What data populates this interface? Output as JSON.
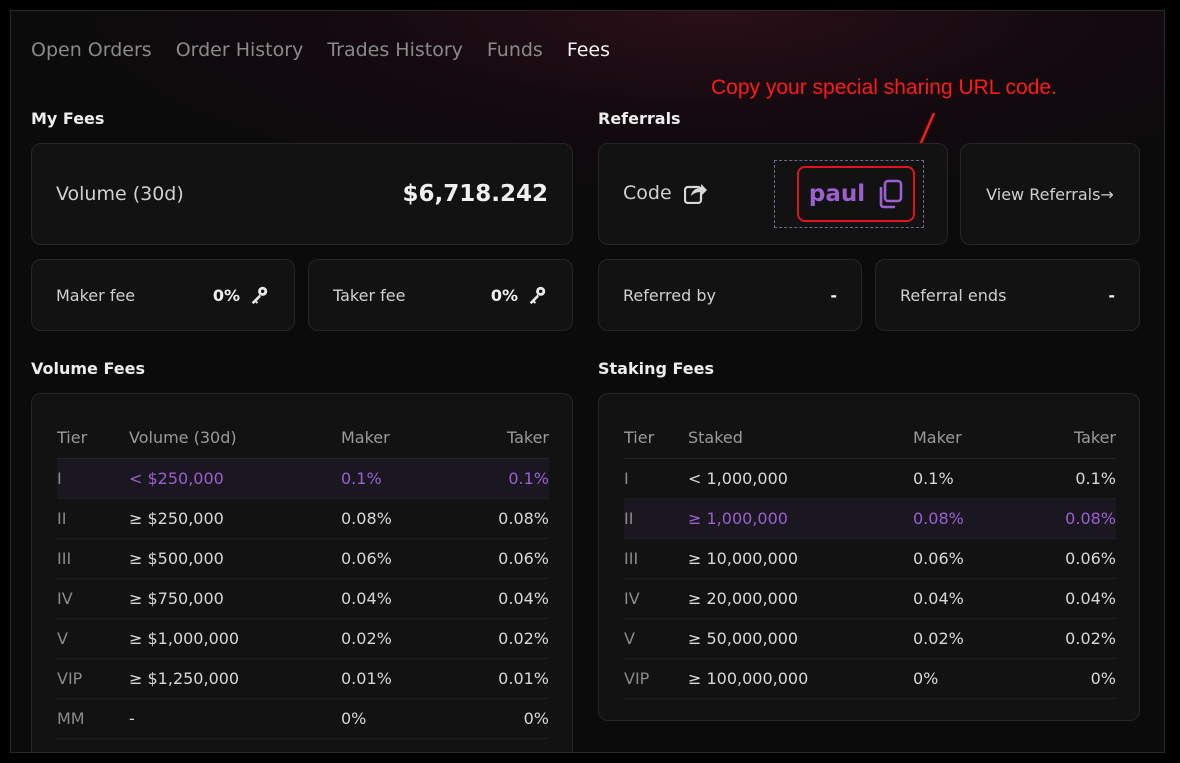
{
  "tabs": [
    "Open Orders",
    "Order History",
    "Trades History",
    "Funds",
    "Fees"
  ],
  "active_tab": "Fees",
  "annotation": "Copy your special sharing URL code.",
  "my_fees": {
    "title": "My Fees",
    "volume_label": "Volume (30d)",
    "volume_value": "$6,718.242",
    "maker_label": "Maker fee",
    "maker_value": "0%",
    "taker_label": "Taker fee",
    "taker_value": "0%"
  },
  "referrals": {
    "title": "Referrals",
    "code_label": "Code",
    "code_value": "paul",
    "view_label": "View Referrals→",
    "referred_by_label": "Referred by",
    "referred_by_value": "-",
    "referral_ends_label": "Referral ends",
    "referral_ends_value": "-"
  },
  "volume_fees": {
    "title": "Volume Fees",
    "headers": [
      "Tier",
      "Volume (30d)",
      "Maker",
      "Taker"
    ],
    "rows": [
      [
        "I",
        "< $250,000",
        "0.1%",
        "0.1%"
      ],
      [
        "II",
        "≥ $250,000",
        "0.08%",
        "0.08%"
      ],
      [
        "III",
        "≥ $500,000",
        "0.06%",
        "0.06%"
      ],
      [
        "IV",
        "≥ $750,000",
        "0.04%",
        "0.04%"
      ],
      [
        "V",
        "≥ $1,000,000",
        "0.02%",
        "0.02%"
      ],
      [
        "VIP",
        "≥ $1,250,000",
        "0.01%",
        "0.01%"
      ],
      [
        "MM",
        "-",
        "0%",
        "0%"
      ]
    ],
    "highlight_row": 0
  },
  "staking_fees": {
    "title": "Staking Fees",
    "headers": [
      "Tier",
      "Staked",
      "Maker",
      "Taker"
    ],
    "rows": [
      [
        "I",
        "< 1,000,000",
        "0.1%",
        "0.1%"
      ],
      [
        "II",
        "≥ 1,000,000",
        "0.08%",
        "0.08%"
      ],
      [
        "III",
        "≥ 10,000,000",
        "0.06%",
        "0.06%"
      ],
      [
        "IV",
        "≥ 20,000,000",
        "0.04%",
        "0.04%"
      ],
      [
        "V",
        "≥ 50,000,000",
        "0.02%",
        "0.02%"
      ],
      [
        "VIP",
        "≥ 100,000,000",
        "0%",
        "0%"
      ]
    ],
    "highlight_row": 1
  },
  "colors": {
    "accent": "#9b5fd0",
    "annotation": "#ff1a1a",
    "background": "#0b0b0b"
  },
  "icons": [
    "share-icon",
    "copy-icon",
    "key-icon",
    "arrow-annotation-icon"
  ]
}
